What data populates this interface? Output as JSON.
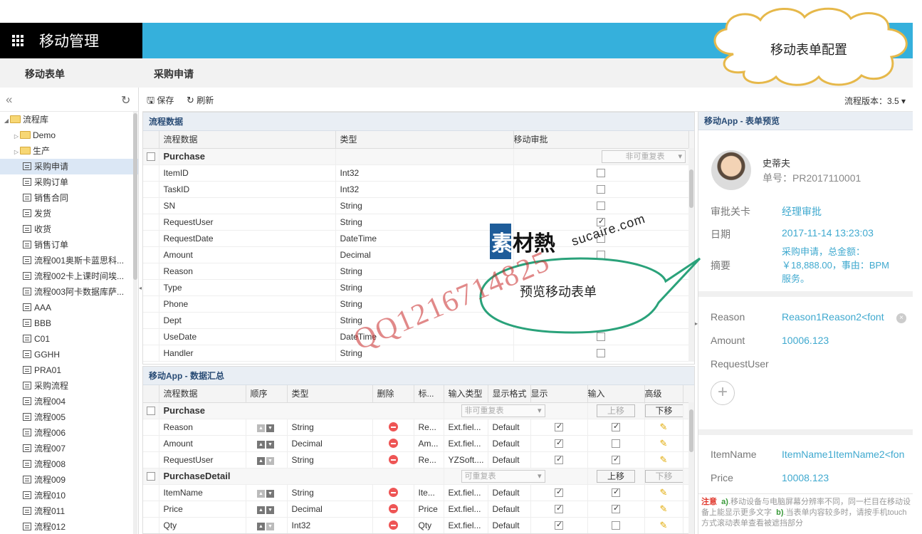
{
  "app": {
    "title": "移动管理"
  },
  "subheader": {
    "left": "移动表单",
    "right": "采购申请"
  },
  "toolbar": {
    "save": "保存",
    "refresh": "刷新",
    "version_label": "流程版本：3.5"
  },
  "tree": [
    {
      "label": "流程库",
      "type": "root"
    },
    {
      "label": "Demo",
      "type": "folder"
    },
    {
      "label": "生产",
      "type": "folder"
    },
    {
      "label": "采购申请",
      "type": "form",
      "selected": true
    },
    {
      "label": "采购订单",
      "type": "form"
    },
    {
      "label": "销售合同",
      "type": "form"
    },
    {
      "label": "发货",
      "type": "form"
    },
    {
      "label": "收货",
      "type": "form"
    },
    {
      "label": "销售订单",
      "type": "form"
    },
    {
      "label": "流程001奥斯卡蓝思科...",
      "type": "form"
    },
    {
      "label": "流程002卡上课时间埃...",
      "type": "form"
    },
    {
      "label": "流程003阿卡数据库萨...",
      "type": "form"
    },
    {
      "label": "AAA",
      "type": "form"
    },
    {
      "label": "BBB",
      "type": "form"
    },
    {
      "label": "C01",
      "type": "form"
    },
    {
      "label": "GGHH",
      "type": "form"
    },
    {
      "label": "PRA01",
      "type": "form"
    },
    {
      "label": "采购流程",
      "type": "form"
    },
    {
      "label": "流程004",
      "type": "form"
    },
    {
      "label": "流程005",
      "type": "form"
    },
    {
      "label": "流程006",
      "type": "form"
    },
    {
      "label": "流程007",
      "type": "form"
    },
    {
      "label": "流程008",
      "type": "form"
    },
    {
      "label": "流程009",
      "type": "form"
    },
    {
      "label": "流程010",
      "type": "form"
    },
    {
      "label": "流程011",
      "type": "form"
    },
    {
      "label": "流程012",
      "type": "form"
    }
  ],
  "process_data": {
    "title": "流程数据",
    "columns": [
      "流程数据",
      "类型",
      "移动审批"
    ],
    "group": {
      "name": "Purchase",
      "select": "非可重复表"
    },
    "rows": [
      {
        "field": "ItemID",
        "type": "Int32",
        "checked": false
      },
      {
        "field": "TaskID",
        "type": "Int32",
        "checked": false
      },
      {
        "field": "SN",
        "type": "String",
        "checked": false
      },
      {
        "field": "RequestUser",
        "type": "String",
        "checked": true
      },
      {
        "field": "RequestDate",
        "type": "DateTime",
        "checked": false
      },
      {
        "field": "Amount",
        "type": "Decimal",
        "checked": false
      },
      {
        "field": "Reason",
        "type": "String",
        "checked": false
      },
      {
        "field": "Type",
        "type": "String",
        "checked": false
      },
      {
        "field": "Phone",
        "type": "String",
        "checked": false
      },
      {
        "field": "Dept",
        "type": "String",
        "checked": false
      },
      {
        "field": "UseDate",
        "type": "DateTime",
        "checked": false
      },
      {
        "field": "Handler",
        "type": "String",
        "checked": false
      }
    ]
  },
  "summary": {
    "title": "移动App - 数据汇总",
    "columns": [
      "流程数据",
      "顺序",
      "类型",
      "删除",
      "标...",
      "输入类型",
      "显示格式",
      "显示",
      "输入",
      "高级"
    ],
    "move_up": "上移",
    "move_down": "下移",
    "groups": [
      {
        "name": "Purchase",
        "select": "非可重复表",
        "rows": [
          {
            "field": "Reason",
            "type": "String",
            "label": "Re...",
            "input": "Ext.fiel...",
            "format": "Default",
            "show": true,
            "inp": true
          },
          {
            "field": "Amount",
            "type": "Decimal",
            "label": "Am...",
            "input": "Ext.fiel...",
            "format": "Default",
            "show": true,
            "inp": false
          },
          {
            "field": "RequestUser",
            "type": "String",
            "label": "Re...",
            "input": "YZSoft....",
            "format": "Default",
            "show": true,
            "inp": true
          }
        ]
      },
      {
        "name": "PurchaseDetail",
        "select": "可重复表",
        "rows": [
          {
            "field": "ItemName",
            "type": "String",
            "label": "Ite...",
            "input": "Ext.fiel...",
            "format": "Default",
            "show": true,
            "inp": true
          },
          {
            "field": "Price",
            "type": "Decimal",
            "label": "Price",
            "input": "Ext.fiel...",
            "format": "Default",
            "show": true,
            "inp": true
          },
          {
            "field": "Qty",
            "type": "Int32",
            "label": "Qty",
            "input": "Ext.fiel...",
            "format": "Default",
            "show": true,
            "inp": false
          }
        ]
      }
    ]
  },
  "preview": {
    "title": "移动App - 表单预览",
    "name": "史蒂夫",
    "number": "单号：PR2017110001",
    "rows": [
      {
        "k": "审批关卡",
        "v": "经理审批"
      },
      {
        "k": "日期",
        "v": "2017-11-14 13:23:03"
      }
    ],
    "summary_label": "摘要",
    "summary_lines": [
      "采购申请，总金额：",
      "￥18,888.00，事由：BPM",
      "服务。"
    ],
    "fields": [
      {
        "k": "Reason",
        "v": "Reason1Reason2<font"
      },
      {
        "k": "Amount",
        "v": "10006.123"
      },
      {
        "k": "RequestUser",
        "v": ""
      },
      {
        "k": "ItemName",
        "v": "ItemName1ItemName2<fon"
      },
      {
        "k": "Price",
        "v": "10008.123"
      }
    ],
    "note_title": "注意",
    "note_a": "a)",
    "note_text1": ".移动设备与电脑屏幕分辨率不同，同一栏目在移动设备上能显示更多文字",
    "note_b": "b)",
    "note_text2": ".当表单内容较多时，请按手机touch方式滚动表单查看被遮挡部分"
  },
  "callouts": {
    "cloud": "移动表单配置",
    "bubble": "预览移动表单"
  },
  "watermark": {
    "logo": "素材熱",
    "url": "sucaire.com",
    "qq": "QQ1216714825"
  }
}
